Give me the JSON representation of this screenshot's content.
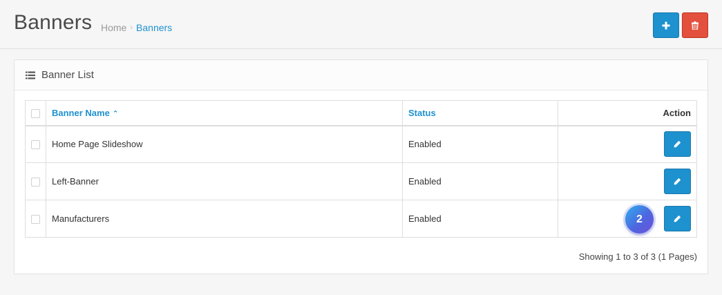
{
  "header": {
    "title": "Banners",
    "breadcrumb": [
      {
        "label": "Home"
      },
      {
        "label": "Banners"
      }
    ],
    "separator": "›",
    "add_icon": "plus-icon",
    "delete_icon": "trash-icon"
  },
  "panel": {
    "title": "Banner List",
    "icon": "list-icon"
  },
  "table": {
    "columns": {
      "name": "Banner Name",
      "sort_indicator": "⌃",
      "status": "Status",
      "action": "Action"
    },
    "rows": [
      {
        "name": "Home Page Slideshow",
        "status": "Enabled"
      },
      {
        "name": "Left-Banner",
        "status": "Enabled"
      },
      {
        "name": "Manufacturers",
        "status": "Enabled"
      }
    ],
    "edit_icon": "pencil-icon"
  },
  "pagination": {
    "summary": "Showing 1 to 3 of 3 (1 Pages)"
  },
  "overlay_badge": {
    "label": "2"
  },
  "colors": {
    "primary": "#1e91cf",
    "danger": "#e3503e",
    "background": "#f6f6f6"
  }
}
